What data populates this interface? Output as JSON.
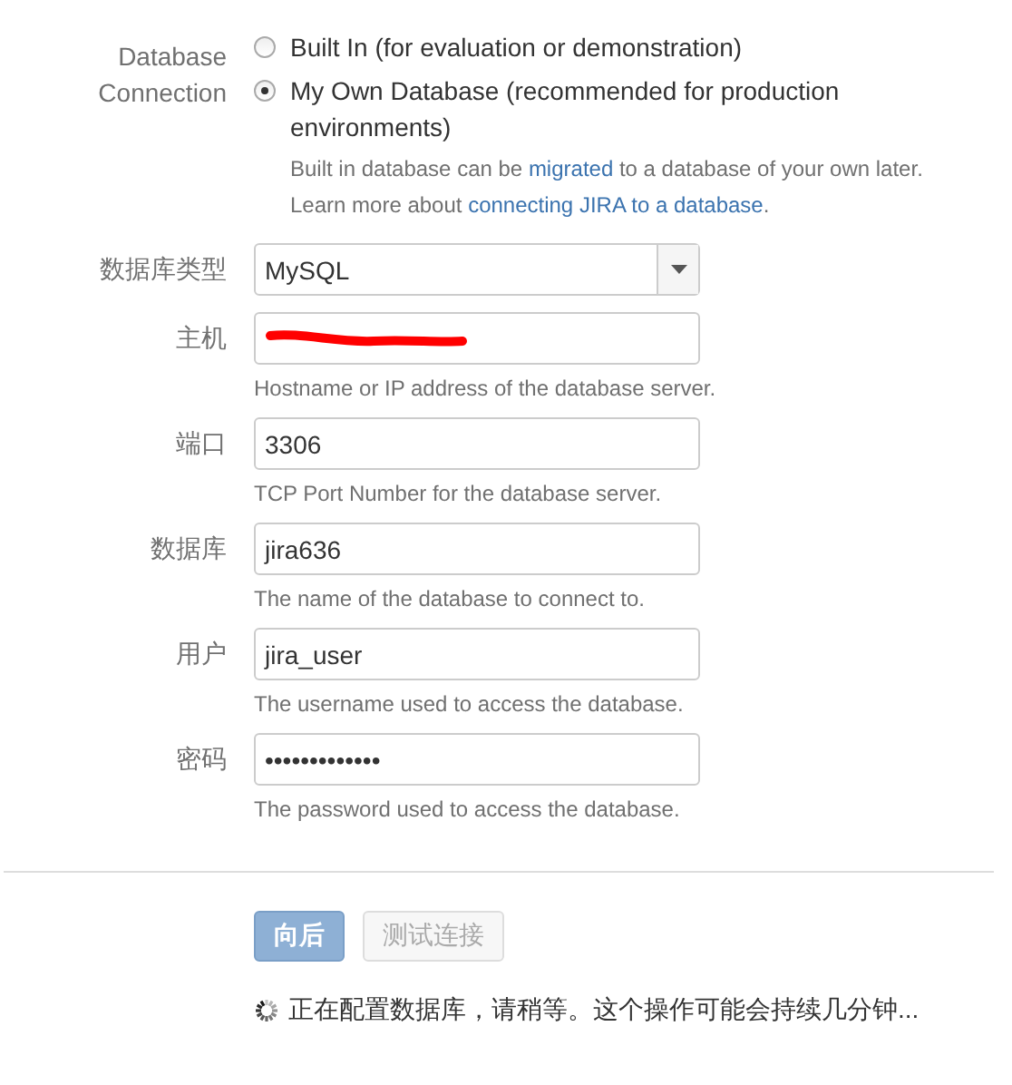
{
  "database_connection": {
    "label": "Database Connection",
    "options": [
      {
        "label": "Built In (for evaluation or demonstration)",
        "selected": false
      },
      {
        "label": "My Own Database (recommended for production environments)",
        "selected": true
      }
    ],
    "help": [
      [
        {
          "text": "Built in database can be "
        },
        {
          "text": "migrated",
          "link": true
        },
        {
          "text": " to a database of your own later."
        }
      ],
      [
        {
          "text": "Learn more about "
        },
        {
          "text": "connecting JIRA to a database",
          "link": true
        },
        {
          "text": "."
        }
      ]
    ]
  },
  "fields": [
    {
      "kind": "select",
      "label": "数据库类型",
      "value": "MySQL"
    },
    {
      "kind": "text",
      "label": "主机",
      "redacted": true,
      "help": "Hostname or IP address of the database server."
    },
    {
      "kind": "text",
      "label": "端口",
      "value": "3306",
      "help": "TCP Port Number for the database server."
    },
    {
      "kind": "text",
      "label": "数据库",
      "value": "jira636",
      "help": "The name of the database to connect to."
    },
    {
      "kind": "text",
      "label": "用户",
      "value": "jira_user",
      "help": "The username used to access the database."
    },
    {
      "kind": "password",
      "label": "密码",
      "value": "•••••••••••••",
      "help": "The password used to access the database."
    }
  ],
  "buttons": [
    {
      "label": "向后",
      "kind": "primary",
      "disabled": false
    },
    {
      "label": "测试连接",
      "kind": "secondary",
      "disabled": true
    }
  ],
  "status": {
    "busy": true,
    "text": "正在配置数据库，请稍等。这个操作可能会持续几分钟..."
  }
}
